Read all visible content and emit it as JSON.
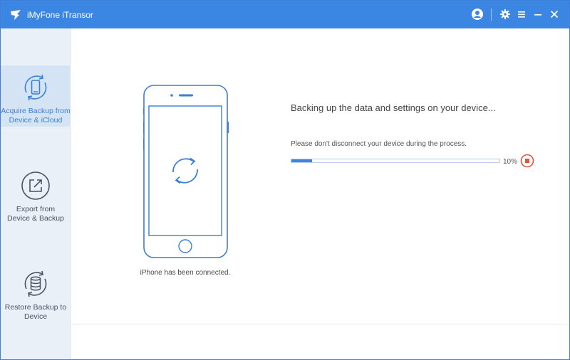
{
  "window": {
    "title": "iMyFone iTransor"
  },
  "titlebar_icons": [
    "account-icon",
    "gear-icon",
    "menu-icon",
    "minimize-icon",
    "close-icon"
  ],
  "sidebar": {
    "items": [
      {
        "label_line1": "Acquire Backup from",
        "label_line2": "Device & iCloud",
        "icon": "phone-refresh-icon",
        "active": true
      },
      {
        "label_line1": "Export from",
        "label_line2": "Device & Backup",
        "icon": "export-icon",
        "active": false
      },
      {
        "label_line1": "Restore Backup to",
        "label_line2": "Device",
        "icon": "database-refresh-icon",
        "active": false
      }
    ]
  },
  "main": {
    "phone_caption": "iPhone has been connected.",
    "status": "Backing up the data and settings on your device...",
    "hint": "Please don't disconnect your device during the process.",
    "progress": {
      "value": 0.1,
      "label": "10%"
    }
  },
  "colors": {
    "accent": "#3b86e3",
    "sidebar_bg": "#eaf0f8",
    "active_bg": "#d5e4f5",
    "stop": "#e2553a"
  }
}
